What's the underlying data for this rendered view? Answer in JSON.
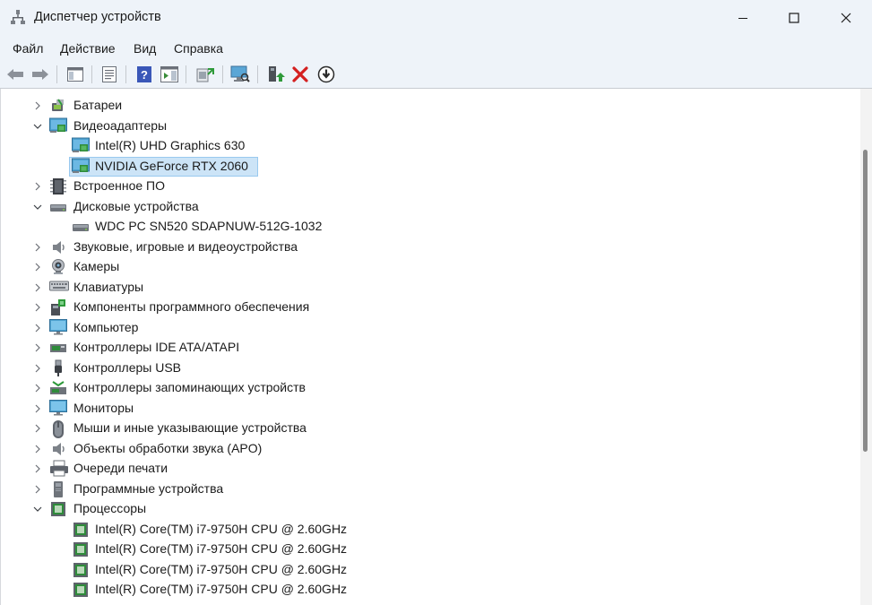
{
  "window": {
    "title": "Диспетчер устройств"
  },
  "menu": [
    {
      "label": "Файл"
    },
    {
      "label": "Действие"
    },
    {
      "label": "Вид"
    },
    {
      "label": "Справка"
    }
  ],
  "toolbar": {
    "buttons": [
      {
        "name": "back-icon"
      },
      {
        "name": "forward-icon"
      },
      {
        "name": "show-hide-console-tree-icon"
      },
      {
        "name": "properties-icon"
      },
      {
        "name": "help-icon"
      },
      {
        "name": "action-pane-icon"
      },
      {
        "name": "update-driver-icon"
      },
      {
        "name": "scan-hardware-icon"
      },
      {
        "name": "enable-device-icon"
      },
      {
        "name": "uninstall-device-icon"
      },
      {
        "name": "download-icon"
      }
    ]
  },
  "tree": {
    "items": [
      {
        "label": "Батареи",
        "expanded": false,
        "icon": "battery-icon"
      },
      {
        "label": "Видеоадаптеры",
        "expanded": true,
        "icon": "display-adapter-icon"
      },
      {
        "label": "Intel(R) UHD Graphics 630",
        "child": true,
        "icon": "display-adapter-icon"
      },
      {
        "label": "NVIDIA GeForce RTX 2060",
        "child": true,
        "selected": true,
        "icon": "display-adapter-icon"
      },
      {
        "label": "Встроенное ПО",
        "expanded": false,
        "icon": "firmware-icon"
      },
      {
        "label": "Дисковые устройства",
        "expanded": true,
        "icon": "disk-drive-icon"
      },
      {
        "label": "WDC PC SN520 SDAPNUW-512G-1032",
        "child": true,
        "icon": "disk-drive-icon"
      },
      {
        "label": "Звуковые, игровые и видеоустройства",
        "expanded": false,
        "icon": "speaker-icon"
      },
      {
        "label": "Камеры",
        "expanded": false,
        "icon": "camera-icon"
      },
      {
        "label": "Клавиатуры",
        "expanded": false,
        "icon": "keyboard-icon"
      },
      {
        "label": "Компоненты программного обеспечения",
        "expanded": false,
        "icon": "software-component-icon"
      },
      {
        "label": "Компьютер",
        "expanded": false,
        "icon": "computer-icon"
      },
      {
        "label": "Контроллеры IDE ATA/ATAPI",
        "expanded": false,
        "icon": "ide-controller-icon"
      },
      {
        "label": "Контроллеры USB",
        "expanded": false,
        "icon": "usb-icon"
      },
      {
        "label": "Контроллеры запоминающих устройств",
        "expanded": false,
        "icon": "storage-controller-icon"
      },
      {
        "label": "Мониторы",
        "expanded": false,
        "icon": "monitor-icon"
      },
      {
        "label": "Мыши и иные указывающие устройства",
        "expanded": false,
        "icon": "mouse-icon"
      },
      {
        "label": "Объекты обработки звука (APO)",
        "expanded": false,
        "icon": "audio-processing-icon"
      },
      {
        "label": "Очереди печати",
        "expanded": false,
        "icon": "printer-icon"
      },
      {
        "label": "Программные устройства",
        "expanded": false,
        "icon": "software-device-icon"
      },
      {
        "label": "Процессоры",
        "expanded": true,
        "icon": "processor-icon"
      },
      {
        "label": "Intel(R) Core(TM) i7-9750H CPU @ 2.60GHz",
        "child": true,
        "icon": "processor-icon"
      },
      {
        "label": "Intel(R) Core(TM) i7-9750H CPU @ 2.60GHz",
        "child": true,
        "icon": "processor-icon"
      },
      {
        "label": "Intel(R) Core(TM) i7-9750H CPU @ 2.60GHz",
        "child": true,
        "icon": "processor-icon"
      },
      {
        "label": "Intel(R) Core(TM) i7-9750H CPU @ 2.60GHz",
        "child": true,
        "icon": "processor-icon"
      }
    ]
  }
}
